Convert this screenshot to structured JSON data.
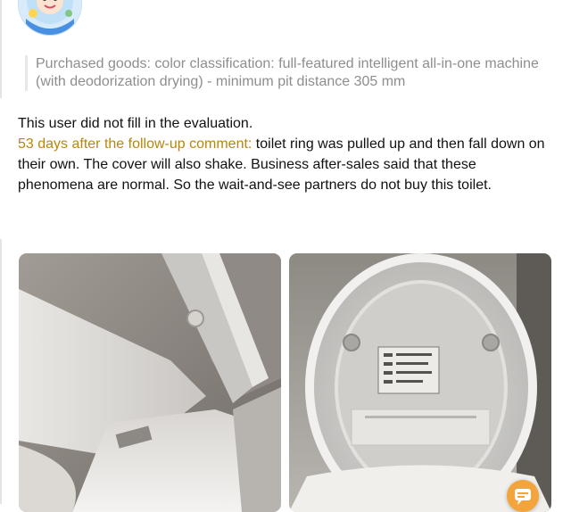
{
  "purchase": {
    "text": "Purchased goods: color classification: full-featured intelligent all-in-one machine (with deodorization drying) - minimum pit distance 305 mm"
  },
  "review": {
    "initial": "This user did not fill in the evaluation.",
    "followup_label": "53 days after the follow-up comment:",
    "followup_text": " toilet ring was pulled up and then fall down on their own. The cover will also shake. Business after-sales said that these phenomena are normal. So the wait-and-see partners do not buy this toilet."
  },
  "colors": {
    "followup_label": "#b8860b",
    "muted_text": "#8e8e8e",
    "float_button": "#f3a43a"
  },
  "icons": {
    "avatar": "cartoon-avatar",
    "floating": "chat-bubble-icon"
  }
}
